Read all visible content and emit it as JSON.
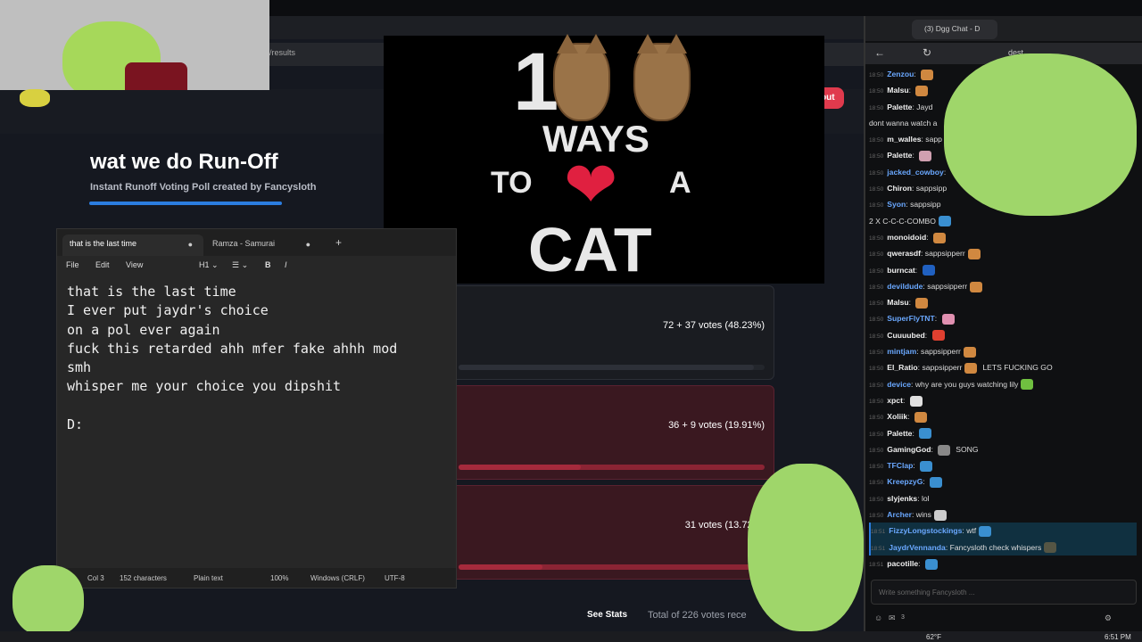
{
  "poll": {
    "url_text": "/results",
    "logout_label": "out",
    "title": "wat we do Run-Off",
    "subtitle": "Instant Runoff Voting Poll created by Fancysloth",
    "options": [
      {
        "votes": "72 + 37 votes (48.23%)",
        "share": 0.4823
      },
      {
        "votes": "36 + 9 votes (19.91%)",
        "share": 0.1991
      },
      {
        "votes": "31 votes (13.72%)",
        "share": 0.1372
      }
    ],
    "see_stats_label": "See Stats",
    "total_votes": "Total of 226 votes rece"
  },
  "thumbnail": {
    "one": "1",
    "ways": "WAYS",
    "to": "TO",
    "heart": "❤",
    "a": "A",
    "cat": "CAT"
  },
  "notepad": {
    "tabs": [
      {
        "label": "that is the last time",
        "dot": "●"
      },
      {
        "label": "Ramza - Samurai",
        "dot": "●"
      }
    ],
    "new_tab": "+",
    "menu": {
      "file": "File",
      "edit": "Edit",
      "view": "View",
      "heading": "H1 ⌄",
      "list": "☰ ⌄",
      "bold": "B",
      "italic": "I"
    },
    "text": "that is the last time\nI ever put jaydr's choice\non a pol ever again\nfuck this retarded ahh mfer fake ahhh mod\nsmh\nwhisper me your choice you dipshit\n\nD:",
    "status": {
      "position": "Col 3",
      "characters": "152 characters",
      "format": "Plain text",
      "zoom": "100%",
      "line_ending": "Windows (CRLF)",
      "encoding": "UTF-8"
    }
  },
  "chat": {
    "tab_title": "(3) Dgg Chat - D",
    "address_fragment": "dest",
    "messages": [
      {
        "ts": "18:50",
        "user": "Zenzou",
        "text": "",
        "blue": true,
        "emote": "#d08840"
      },
      {
        "ts": "18:50",
        "user": "Malsu",
        "text": "",
        "blue": false,
        "emote": "#d08840"
      },
      {
        "ts": "18:50",
        "user": "Palette",
        "text": "Jayd",
        "blue": false,
        "emote": ""
      },
      {
        "ts": "",
        "user": "",
        "text": "dont wanna watch a",
        "blue": false,
        "emote": ""
      },
      {
        "ts": "18:50",
        "user": "m_walles",
        "text": "sapp",
        "blue": false,
        "emote": ""
      },
      {
        "ts": "18:50",
        "user": "Palette",
        "text": "",
        "blue": false,
        "emote": "#d0a0b0"
      },
      {
        "ts": "18:50",
        "user": "jacked_cowboy",
        "text": "",
        "blue": true,
        "emote": ""
      },
      {
        "ts": "18:50",
        "user": "Chiron",
        "text": "sappsipp",
        "blue": false,
        "emote": ""
      },
      {
        "ts": "18:50",
        "user": "Syon",
        "text": "sappsipp",
        "blue": true,
        "emote": ""
      },
      {
        "ts": "",
        "user": "",
        "text": "2 X C-C-C-COMBO",
        "blue": false,
        "emote": "#3a8fd0"
      },
      {
        "ts": "18:50",
        "user": "monoidoid",
        "text": "",
        "blue": false,
        "emote": "#d08840"
      },
      {
        "ts": "18:50",
        "user": "qwerasdf",
        "text": "sappsipperr",
        "blue": false,
        "emote": "#d08840"
      },
      {
        "ts": "18:50",
        "user": "burncat",
        "text": "",
        "blue": false,
        "emote": "#2060c0"
      },
      {
        "ts": "18:50",
        "user": "devildude",
        "text": "sappsipperr",
        "blue": true,
        "emote": "#d08840"
      },
      {
        "ts": "18:50",
        "user": "Malsu",
        "text": "",
        "blue": false,
        "emote": "#d08840"
      },
      {
        "ts": "18:50",
        "user": "SuperFlyTNT",
        "text": "",
        "blue": true,
        "emote": "#e090b0"
      },
      {
        "ts": "18:50",
        "user": "Cuuuubed",
        "text": "",
        "blue": false,
        "emote": "#e04030"
      },
      {
        "ts": "18:50",
        "user": "mintjam",
        "text": "sappsipperr",
        "blue": true,
        "emote": "#d08840"
      },
      {
        "ts": "18:50",
        "user": "El_Ratio",
        "text": "sappsipperr",
        "blue": false,
        "emote": "#d08840",
        "after": "LETS FUCKING GO"
      },
      {
        "ts": "18:50",
        "user": "device",
        "text": "why are you guys watching lily",
        "blue": true,
        "emote": "#70c040"
      },
      {
        "ts": "18:50",
        "user": "xpct",
        "text": "",
        "blue": false,
        "emote": "#e0e0e0"
      },
      {
        "ts": "18:50",
        "user": "Xoliik",
        "text": "",
        "blue": false,
        "emote": "#d08840"
      },
      {
        "ts": "18:50",
        "user": "Palette",
        "text": "",
        "blue": false,
        "emote": "#3a8fd0"
      },
      {
        "ts": "18:50",
        "user": "GamingGod",
        "text": "",
        "blue": false,
        "emote": "#888",
        "after": "SONG"
      },
      {
        "ts": "18:50",
        "user": "TFClap",
        "text": "",
        "blue": true,
        "emote": "#3a8fd0"
      },
      {
        "ts": "18:50",
        "user": "KreepzyG",
        "text": "",
        "blue": true,
        "emote": "#3a8fd0"
      },
      {
        "ts": "18:50",
        "user": "slyjenks",
        "text": "lol",
        "blue": false,
        "emote": ""
      },
      {
        "ts": "18:50",
        "user": "Archer",
        "text": "wins",
        "blue": true,
        "emote": "#ccc"
      },
      {
        "ts": "18:51",
        "user": "FizzyLongstockings",
        "text": "wtf",
        "blue": true,
        "emote": "#3a8fd0",
        "highlight": true
      },
      {
        "ts": "18:51",
        "user": "JaydrVennanda",
        "text": "Fancysloth check whispers",
        "blue": true,
        "emote": "#554",
        "highlight": true
      },
      {
        "ts": "18:51",
        "user": "pacotille",
        "text": "",
        "blue": false,
        "emote": "#3a8fd0"
      }
    ],
    "input_placeholder": "Write something Fancysloth ...",
    "whisper_count": "3"
  },
  "taskbar": {
    "weather": "62°F",
    "time": "6:51 PM"
  }
}
